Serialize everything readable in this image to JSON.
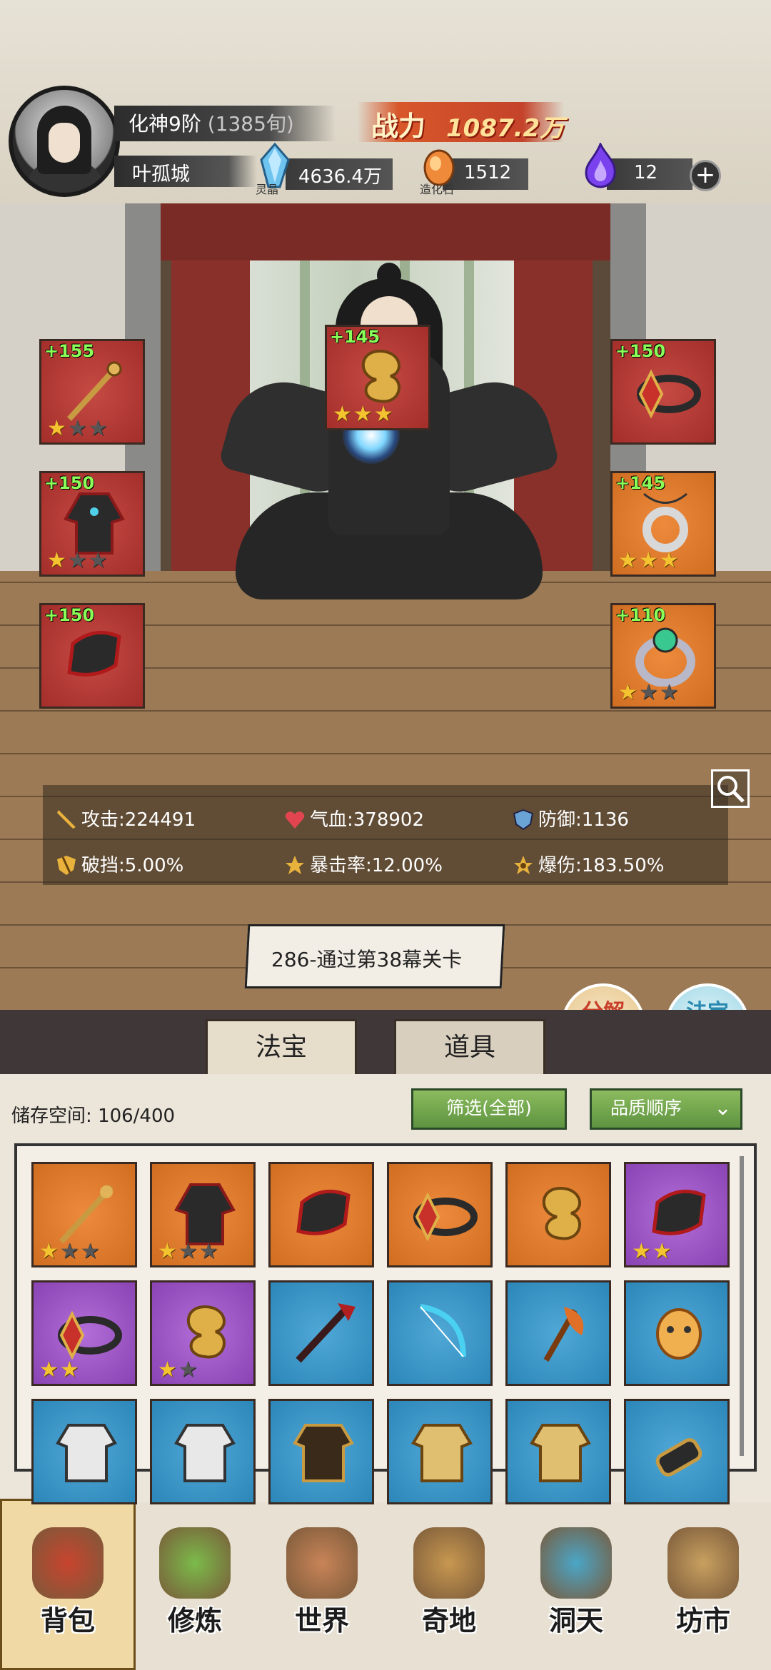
{
  "player": {
    "rank": "化神9阶",
    "rank_age": "(1385旬)",
    "name": "叶孤城"
  },
  "power": {
    "label": "战力",
    "value": "1087.2万"
  },
  "resources": [
    {
      "name": "灵晶",
      "value": "4636.4万",
      "icon": "blue-crystal-icon",
      "color": "#6fc3ef"
    },
    {
      "name": "造化石",
      "value": "1512",
      "icon": "orange-stone-icon",
      "color": "#ef8a3a"
    },
    {
      "name": "",
      "value": "12",
      "icon": "purple-flame-icon",
      "color": "#7a42ef"
    }
  ],
  "equipped": [
    {
      "level": "+155",
      "stars": 1,
      "rarity": "red",
      "icon": "staff-icon"
    },
    {
      "level": "+150",
      "stars": 1,
      "rarity": "red",
      "icon": "robe-icon"
    },
    {
      "level": "+150",
      "stars": 0,
      "rarity": "red",
      "icon": "boots-icon"
    },
    {
      "level": "+145",
      "stars": 3,
      "rarity": "red",
      "icon": "gold-cloud-charm-icon"
    },
    {
      "level": "+150",
      "stars": 0,
      "rarity": "red",
      "icon": "crown-band-icon"
    },
    {
      "level": "+145",
      "stars": 3,
      "rarity": "orange",
      "icon": "jade-pendant-icon"
    },
    {
      "level": "+110",
      "stars": 1,
      "rarity": "orange",
      "icon": "ring-icon"
    }
  ],
  "stats": [
    {
      "label": "攻击:",
      "value": "224491",
      "icon": "sword-icon",
      "color": "#e8b23c"
    },
    {
      "label": "气血:",
      "value": "378902",
      "icon": "heart-icon",
      "color": "#e2454f"
    },
    {
      "label": "防御:",
      "value": "1136",
      "icon": "shield-icon",
      "color": "#6aa4d6"
    },
    {
      "label": "破挡:",
      "value": "5.00%",
      "icon": "broken-shield-icon",
      "color": "#e8b23c"
    },
    {
      "label": "暴击率:",
      "value": "12.00%",
      "icon": "crit-icon",
      "color": "#e8b23c"
    },
    {
      "label": "爆伤:",
      "value": "183.50%",
      "icon": "crit-damage-icon",
      "color": "#e8b23c"
    }
  ],
  "quest": "286-通过第38幕关卡",
  "round_buttons": {
    "decompose": "分解再造",
    "synthesize": "法宝合成"
  },
  "tabs": {
    "treasure": "法宝",
    "items": "道具"
  },
  "inventory": {
    "storage_label": "储存空间:",
    "storage_value": "106/400",
    "filter": "筛选(全部)",
    "sort": "品质顺序",
    "items": [
      {
        "rarity": "orange",
        "stars": 1,
        "icon": "staff-icon"
      },
      {
        "rarity": "orange",
        "stars": 1,
        "icon": "robe-icon"
      },
      {
        "rarity": "orange",
        "stars": null,
        "icon": "boots-icon"
      },
      {
        "rarity": "orange",
        "stars": null,
        "icon": "crown-band-icon"
      },
      {
        "rarity": "orange",
        "stars": null,
        "icon": "gold-cloud-charm-icon"
      },
      {
        "rarity": "purple",
        "stars": 2,
        "icon": "boots-icon"
      },
      {
        "rarity": "purple",
        "stars": 2,
        "icon": "crown-band-icon"
      },
      {
        "rarity": "purple",
        "stars": 1,
        "icon": "gold-cloud-charm-icon"
      },
      {
        "rarity": "blue",
        "stars": null,
        "icon": "spear-icon"
      },
      {
        "rarity": "blue",
        "stars": null,
        "icon": "bow-icon"
      },
      {
        "rarity": "blue",
        "stars": null,
        "icon": "axe-icon"
      },
      {
        "rarity": "blue",
        "stars": null,
        "icon": "mask-icon"
      },
      {
        "rarity": "blue",
        "stars": null,
        "icon": "white-armor-icon"
      },
      {
        "rarity": "blue",
        "stars": null,
        "icon": "white-armor-icon"
      },
      {
        "rarity": "blue",
        "stars": null,
        "icon": "dark-robe-icon"
      },
      {
        "rarity": "blue",
        "stars": null,
        "icon": "gold-armor-icon"
      },
      {
        "rarity": "blue",
        "stars": null,
        "icon": "gold-armor-icon"
      },
      {
        "rarity": "blue",
        "stars": null,
        "icon": "bracer-icon"
      }
    ]
  },
  "nav": [
    {
      "label": "背包",
      "icon": "bag-icon",
      "color": "#c8442e"
    },
    {
      "label": "修炼",
      "icon": "lotus-icon",
      "color": "#7bbb4a"
    },
    {
      "label": "世界",
      "icon": "scroll-map-icon",
      "color": "#c98458"
    },
    {
      "label": "奇地",
      "icon": "pagoda-icon",
      "color": "#c89850"
    },
    {
      "label": "洞天",
      "icon": "portal-icon",
      "color": "#4aa6c8"
    },
    {
      "label": "坊市",
      "icon": "market-stall-icon",
      "color": "#c8a060"
    }
  ]
}
